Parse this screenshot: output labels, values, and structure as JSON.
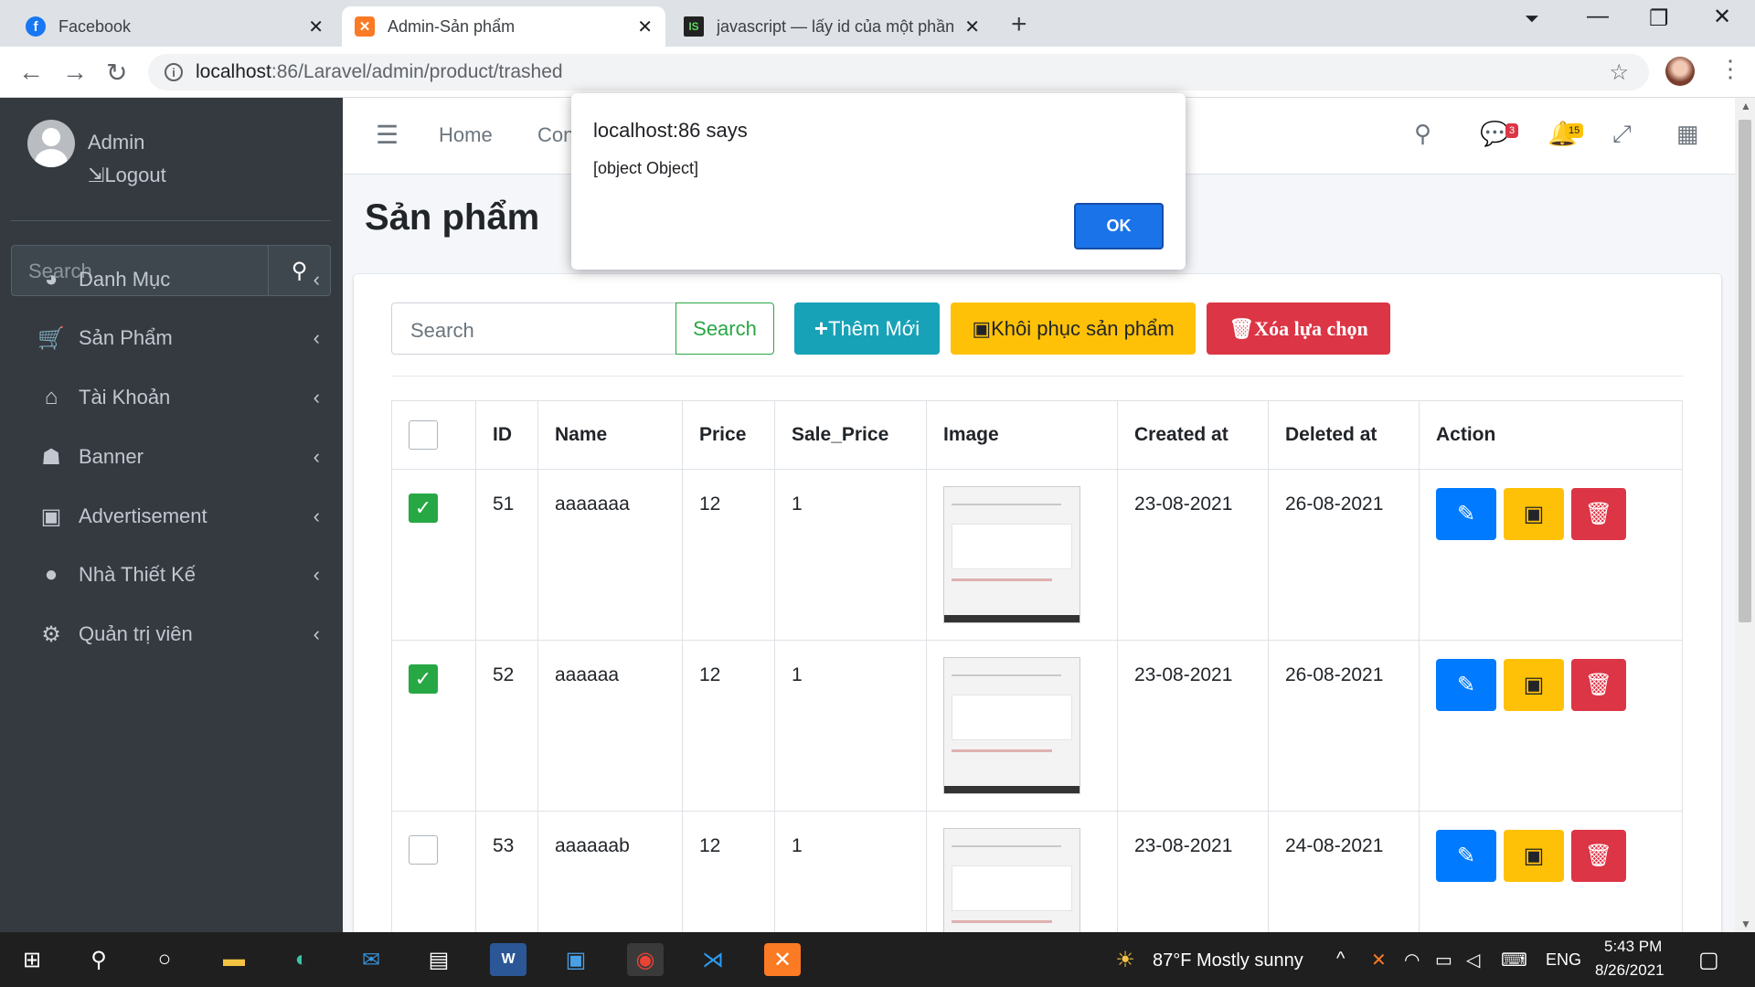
{
  "browser": {
    "tabs": [
      {
        "title": "Facebook",
        "favicon": "facebook-icon",
        "color": "#1877f2"
      },
      {
        "title": "Admin-Sản phẩm",
        "favicon": "xampp-icon",
        "color": "#fb7a24"
      },
      {
        "title": "javascript — lấy id của một phần",
        "favicon": "stackoverflow-icon",
        "color": "#222222"
      }
    ],
    "url_host": "localhost",
    "url_path": ":86/Laravel/admin/product/trashed"
  },
  "sidebar": {
    "user": "Admin",
    "logout": "Logout",
    "search_placeholder": "Search",
    "items": [
      {
        "label": "Danh Mục",
        "icon": "pie-chart-icon"
      },
      {
        "label": "Sản Phẩm",
        "icon": "cart-icon"
      },
      {
        "label": "Tài Khoản",
        "icon": "user-lock-icon"
      },
      {
        "label": "Banner",
        "icon": "robot-icon"
      },
      {
        "label": "Advertisement",
        "icon": "camera-icon"
      },
      {
        "label": "Nhà Thiết Kế",
        "icon": "comment-dots-icon"
      },
      {
        "label": "Quản trị viên",
        "icon": "user-cog-icon"
      }
    ]
  },
  "topnav": {
    "home": "Home",
    "contact": "Con",
    "messages_count": "3",
    "notifications_count": "15"
  },
  "page": {
    "title": "Sản phẩm",
    "search_placeholder": "Search",
    "search_button": "Search",
    "add_button": "Thêm Mới",
    "restore_button": "Khôi phục sản phẩm",
    "delete_selected_button": "Xóa lựa chọn"
  },
  "table": {
    "headers": [
      "ID",
      "Name",
      "Price",
      "Sale_Price",
      "Image",
      "Created at",
      "Deleted at",
      "Action"
    ],
    "rows": [
      {
        "checked": true,
        "id": "51",
        "name": "aaaaaaa",
        "price": "12",
        "sale_price": "1",
        "created": "23-08-2021",
        "deleted": "26-08-2021"
      },
      {
        "checked": true,
        "id": "52",
        "name": "aaaaaa",
        "price": "12",
        "sale_price": "1",
        "created": "23-08-2021",
        "deleted": "26-08-2021"
      },
      {
        "checked": false,
        "id": "53",
        "name": "aaaaaab",
        "price": "12",
        "sale_price": "1",
        "created": "23-08-2021",
        "deleted": "24-08-2021"
      }
    ]
  },
  "dialog": {
    "title": "localhost:86 says",
    "message": "[object Object]",
    "ok": "OK"
  },
  "taskbar": {
    "weather": "87°F  Mostly sunny",
    "lang": "ENG",
    "time": "5:43 PM",
    "date": "8/26/2021"
  },
  "colors": {
    "primary": "#007bff",
    "warning": "#ffc107",
    "danger": "#dc3545",
    "info": "#17a2b8",
    "success": "#28a745",
    "sidebar": "#343a40"
  }
}
